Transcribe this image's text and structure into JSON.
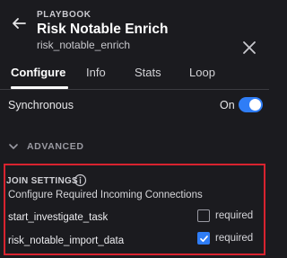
{
  "header": {
    "eyebrow": "PLAYBOOK",
    "title": "Risk Notable Enrich",
    "subtitle": "risk_notable_enrich",
    "back_icon": "arrow-left-icon",
    "close_icon": "close-icon"
  },
  "tabs": [
    {
      "label": "Configure",
      "active": true
    },
    {
      "label": "Info",
      "active": false
    },
    {
      "label": "Stats",
      "active": false
    },
    {
      "label": "Loop",
      "active": false
    }
  ],
  "synchronous": {
    "label": "Synchronous",
    "state_label": "On",
    "enabled": true
  },
  "advanced": {
    "label": "ADVANCED",
    "expanded": true
  },
  "join_settings": {
    "title": "JOIN SETTINGS",
    "description": "Configure Required Incoming Connections",
    "connections": [
      {
        "name": "start_investigate_task",
        "required_label": "required",
        "required": false
      },
      {
        "name": "risk_notable_import_data",
        "required_label": "required",
        "required": true
      }
    ]
  },
  "colors": {
    "background": "#1b1b1f",
    "accent": "#2f7df6",
    "highlight_border": "#d8232f"
  }
}
